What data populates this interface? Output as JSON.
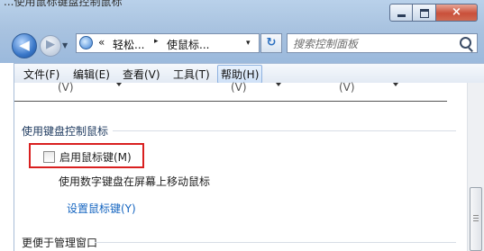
{
  "window": {
    "top_cut_text": "...使用鼠标键盘控制鼠标",
    "caption_close_glyph": "×"
  },
  "address": {
    "overflow_glyph": "«",
    "crumb1": "轻松...",
    "separator_glyph": "▸",
    "crumb2": "使鼠标...",
    "dropdown_glyph": "▾",
    "refresh_glyph": "↻"
  },
  "search": {
    "placeholder": "搜索控制面板"
  },
  "menu": {
    "items": [
      "文件(F)",
      "编辑(E)",
      "查看(V)",
      "工具(T)",
      "帮助(H)"
    ]
  },
  "content": {
    "prev_fragments": [
      "(V)",
      "(V)",
      "(V)"
    ],
    "section1_title": "使用键盘控制鼠标",
    "checkbox_label": "启用鼠标键(M)",
    "checkbox_checked": false,
    "checkbox_description": "使用数字键盘在屏幕上移动鼠标",
    "setup_link": "设置鼠标键(Y)",
    "section2_title": "更便于管理窗口"
  },
  "colors": {
    "link": "#1565c0",
    "highlight_border": "#d92020",
    "chrome": "#a9c3e0"
  }
}
